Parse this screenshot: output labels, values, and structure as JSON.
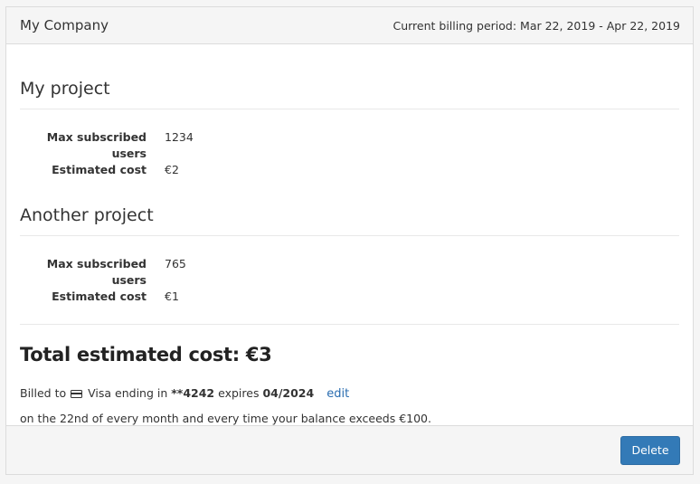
{
  "header": {
    "company": "My Company",
    "billing_period": "Current billing period: Mar 22, 2019 - Apr 22, 2019"
  },
  "projects": [
    {
      "title": "My project",
      "rows": [
        {
          "label": "Max subscribed users",
          "value": "1234"
        },
        {
          "label": "Estimated cost",
          "value": "€2"
        }
      ]
    },
    {
      "title": "Another project",
      "rows": [
        {
          "label": "Max subscribed users",
          "value": "765"
        },
        {
          "label": "Estimated cost",
          "value": "€1"
        }
      ]
    }
  ],
  "total": "Total estimated cost: €3",
  "billing": {
    "prefix": "Billed to",
    "card_icon": "credit-card-icon",
    "card_text": "Visa ending in",
    "card_number": "**4242",
    "expires_text": "expires",
    "expires_date": "04/2024",
    "edit_label": "edit",
    "schedule": "on the 22nd of every month and every time your balance exceeds €100."
  },
  "footer": {
    "delete_label": "Delete"
  },
  "colors": {
    "primary_button": "#337ab7",
    "link": "#2a6db0"
  }
}
